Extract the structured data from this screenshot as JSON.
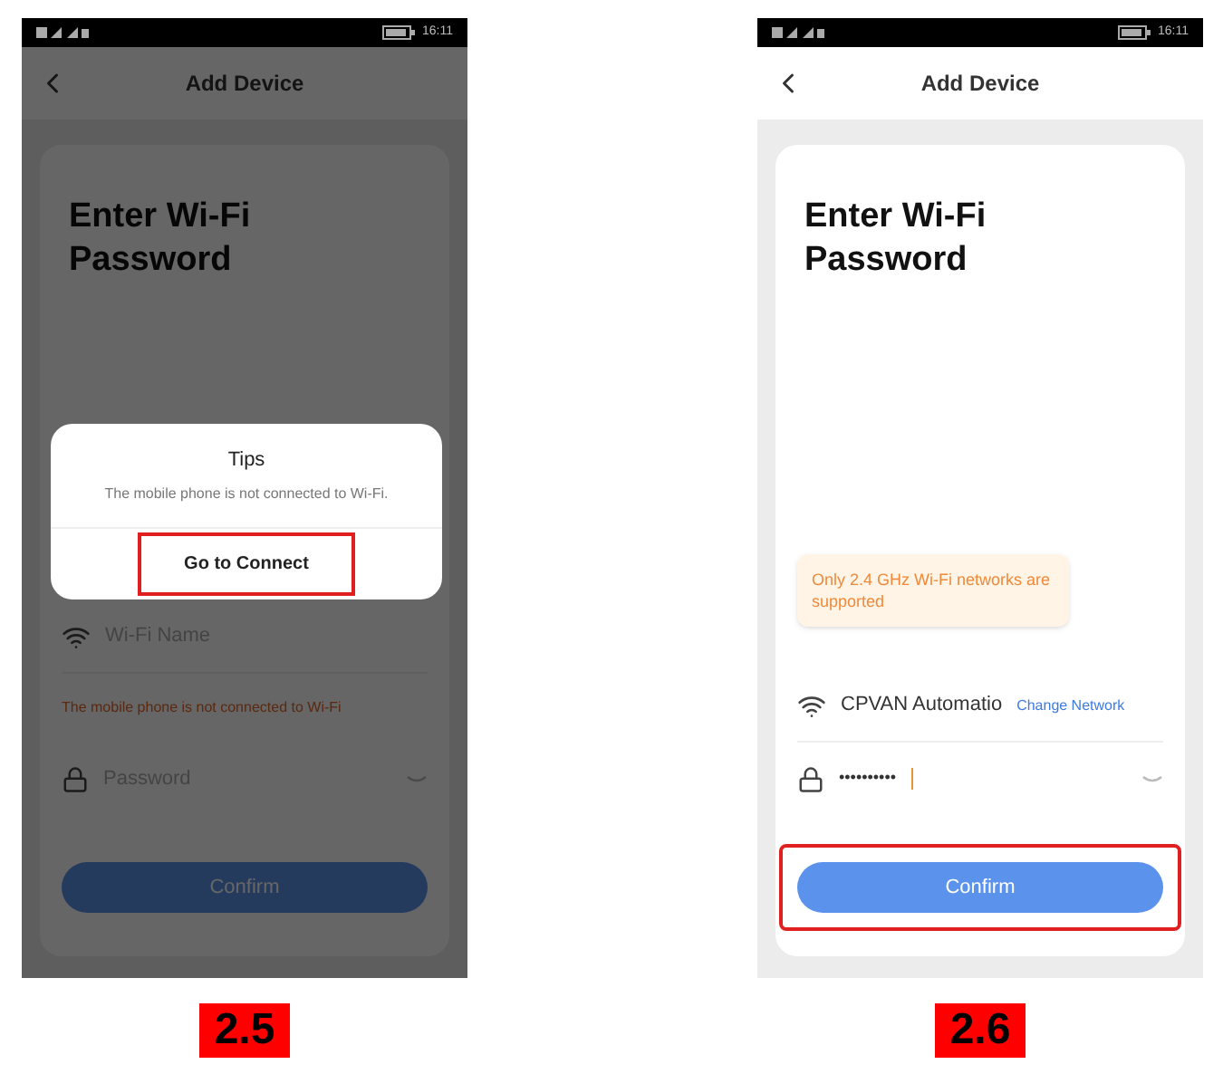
{
  "screens": [
    {
      "caption": "2.5",
      "status_time": "16:11",
      "title": "Add Device",
      "heading": "Enter Wi-Fi Password",
      "dimmed": true,
      "dialog": {
        "title": "Tips",
        "message": "The mobile phone is not connected to Wi-Fi.",
        "action": "Go to Connect",
        "highlighted": true
      },
      "message": {
        "kind": "inline",
        "text": "The mobile phone is not connected to Wi-Fi"
      },
      "wifi": {
        "placeholder": "Wi-Fi Name"
      },
      "password": {
        "placeholder": "Password"
      },
      "confirm": {
        "label": "Confirm",
        "highlighted": false
      }
    },
    {
      "caption": "2.6",
      "status_time": "16:11",
      "title": "Add Device",
      "heading": "Enter Wi-Fi Password",
      "dimmed": false,
      "message": {
        "kind": "bubble",
        "text": "Only 2.4 GHz Wi-Fi networks are supported"
      },
      "wifi": {
        "value": "CPVAN Automatio",
        "link": "Change Network"
      },
      "password": {
        "value": "••••••••••",
        "cursor": true
      },
      "confirm": {
        "label": "Confirm",
        "highlighted": true
      }
    }
  ]
}
